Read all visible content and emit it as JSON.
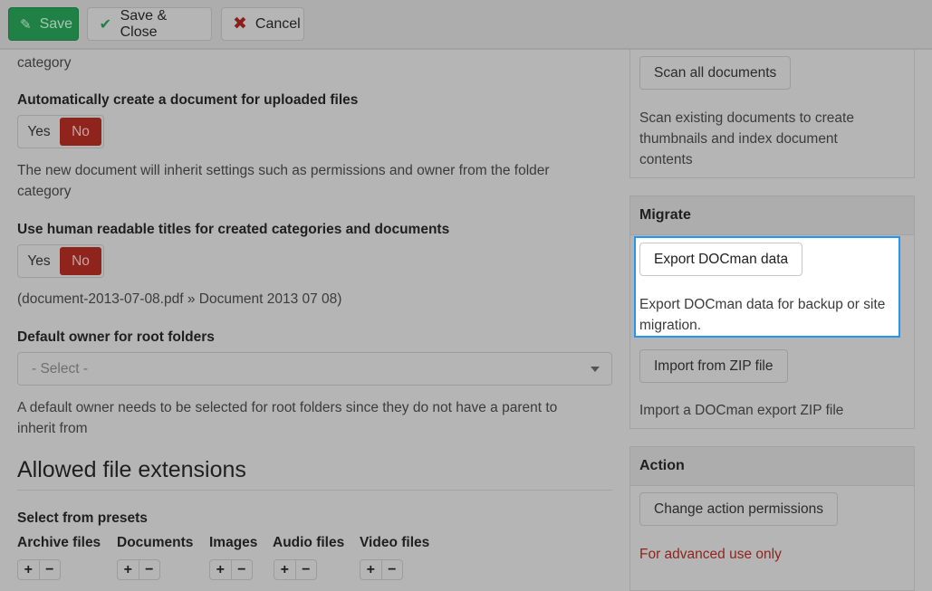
{
  "toolbar": {
    "save_label": "Save",
    "save_close_label": "Save & Close",
    "cancel_label": "Cancel"
  },
  "main": {
    "top_cut_text": "category",
    "auto_create": {
      "label": "Automatically create a document for uploaded files",
      "yes": "Yes",
      "no": "No",
      "selected": "No",
      "help_line1": "The new document will inherit settings such as permissions and owner from the folder",
      "help_line2": "category"
    },
    "human_titles": {
      "label": "Use human readable titles for created categories and documents",
      "yes": "Yes",
      "no": "No",
      "selected": "No",
      "example": "(document-2013-07-08.pdf » Document 2013 07 08)"
    },
    "default_owner": {
      "label": "Default owner for root folders",
      "placeholder": "- Select -",
      "help_line1": "A default owner needs to be selected for root folders since they do not have a parent to",
      "help_line2": "inherit from"
    },
    "extensions": {
      "heading": "Allowed file extensions",
      "presets_label": "Select from presets",
      "presets": [
        {
          "label": "Archive files",
          "add": "+",
          "remove": "−"
        },
        {
          "label": "Documents",
          "add": "+",
          "remove": "−"
        },
        {
          "label": "Images",
          "add": "+",
          "remove": "−"
        },
        {
          "label": "Audio files",
          "add": "+",
          "remove": "−"
        },
        {
          "label": "Video files",
          "add": "+",
          "remove": "−"
        }
      ]
    }
  },
  "sidebar": {
    "scan": {
      "button": "Scan all documents",
      "help_line1": "Scan existing documents to create",
      "help_line2": "thumbnails and index document",
      "help_line3": "contents"
    },
    "migrate": {
      "title": "Migrate",
      "export_button": "Export DOCman data",
      "export_help_line1": "Export DOCman data for backup or site",
      "export_help_line2": "migration.",
      "import_button": "Import from ZIP file",
      "import_help": "Import a DOCman export ZIP file"
    },
    "action": {
      "title": "Action",
      "button": "Change action permissions",
      "warning": "For advanced use only"
    }
  },
  "colors": {
    "save_green": "#1f8146",
    "no_red": "#8f241d",
    "highlight_blue": "#2196f3",
    "warning_red": "#8f241d"
  }
}
